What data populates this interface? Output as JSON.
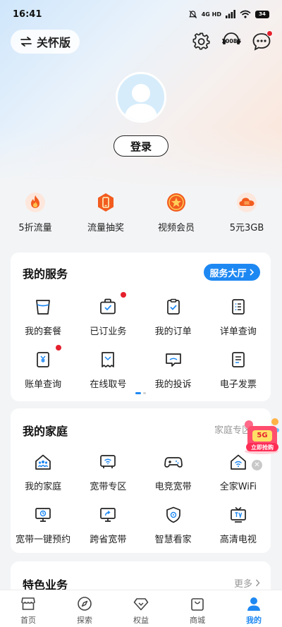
{
  "status_bar": {
    "time": "16:41",
    "network": "4G HD",
    "battery": "34"
  },
  "header": {
    "care_label": "关怀版",
    "hotline": "10086",
    "icons": [
      "settings-icon",
      "hotline-icon",
      "message-icon"
    ]
  },
  "profile": {
    "login_label": "登录"
  },
  "quick_links": [
    {
      "label": "5折流量",
      "icon": "flame-icon"
    },
    {
      "label": "流量抽奖",
      "icon": "phone-lottery-icon"
    },
    {
      "label": "视频会员",
      "icon": "star-badge-icon"
    },
    {
      "label": "5元3GB",
      "icon": "cloud-data-icon"
    }
  ],
  "services": {
    "title": "我的服务",
    "hall_button": "服务大厅",
    "items": [
      {
        "label": "我的套餐",
        "icon": "package-icon",
        "dot": false
      },
      {
        "label": "已订业务",
        "icon": "subscribed-bag-icon",
        "dot": true
      },
      {
        "label": "我的订单",
        "icon": "clipboard-check-icon",
        "dot": false
      },
      {
        "label": "详单查询",
        "icon": "list-document-icon",
        "dot": false
      },
      {
        "label": "账单查询",
        "icon": "bill-yen-icon",
        "dot": true
      },
      {
        "label": "在线取号",
        "icon": "ticket-icon",
        "dot": false
      },
      {
        "label": "我的投诉",
        "icon": "complaint-chat-icon",
        "dot": false
      },
      {
        "label": "电子发票",
        "icon": "invoice-icon",
        "dot": false
      }
    ]
  },
  "family": {
    "title": "我的家庭",
    "zone_link": "家庭专区",
    "items": [
      {
        "label": "我的家庭",
        "icon": "family-home-icon"
      },
      {
        "label": "宽带专区",
        "icon": "router-icon"
      },
      {
        "label": "电竞宽带",
        "icon": "gamepad-icon"
      },
      {
        "label": "全家WiFi",
        "icon": "home-wifi-icon"
      },
      {
        "label": "宽带一键预约",
        "icon": "monitor-clock-icon"
      },
      {
        "label": "跨省宽带",
        "icon": "monitor-share-icon"
      },
      {
        "label": "智慧看家",
        "icon": "shield-camera-icon"
      },
      {
        "label": "高清电视",
        "icon": "tv-icon"
      }
    ]
  },
  "promo": {
    "label": "立即抢购",
    "badge": "5G"
  },
  "featured": {
    "title": "特色业务",
    "more": "更多"
  },
  "tabbar": [
    {
      "label": "首页",
      "icon": "home-store-icon",
      "active": false
    },
    {
      "label": "探索",
      "icon": "compass-icon",
      "active": false
    },
    {
      "label": "权益",
      "icon": "diamond-icon",
      "active": false
    },
    {
      "label": "商城",
      "icon": "shopping-bag-icon",
      "active": false
    },
    {
      "label": "我的",
      "icon": "person-icon",
      "active": true
    }
  ],
  "colors": {
    "accent": "#1e88f2",
    "badge_red": "#e5202d",
    "quick_orange": "#f25c1f"
  }
}
